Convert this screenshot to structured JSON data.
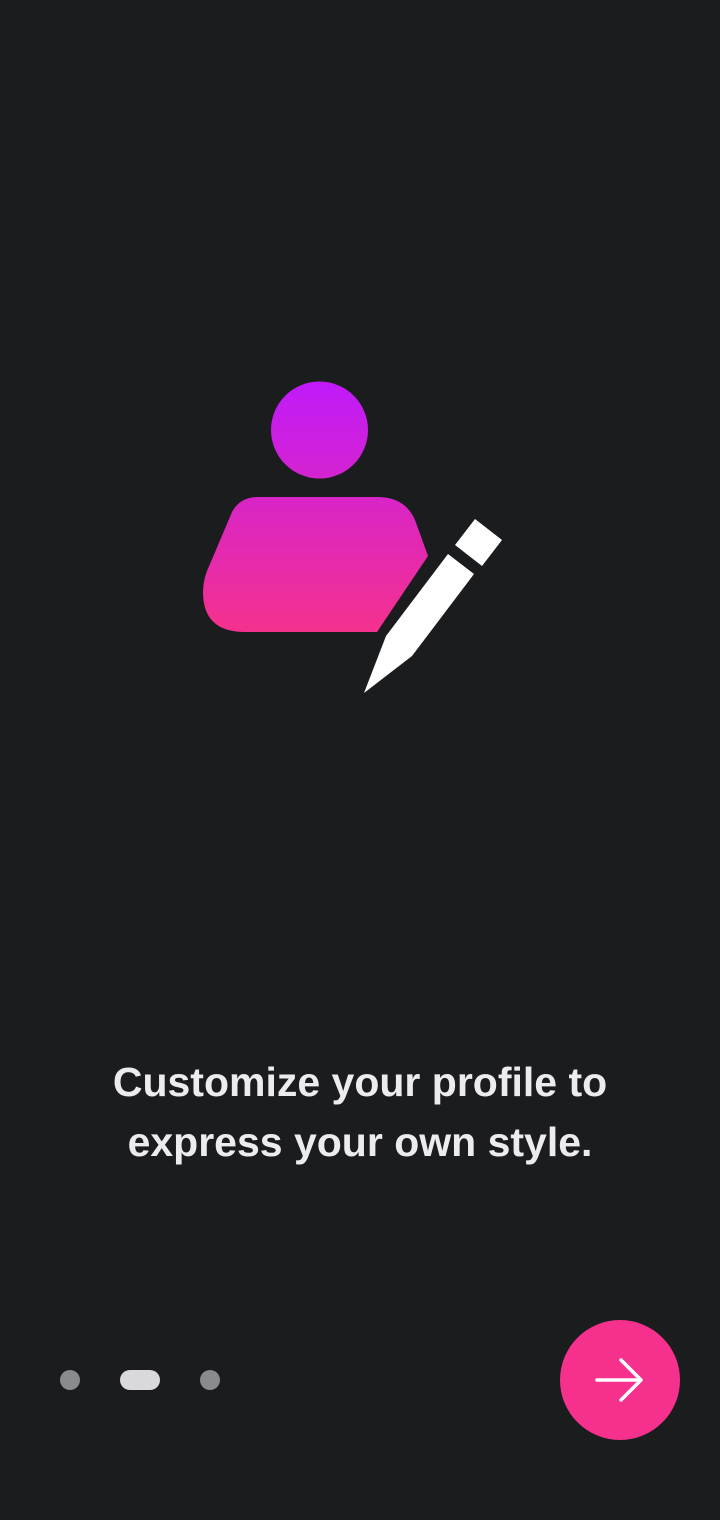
{
  "onboarding": {
    "headline": "Customize your profile to\nexpress your own style.",
    "illustration_icon": "profile-edit-icon",
    "page_indicator": {
      "total": 3,
      "current": 2
    },
    "next_button": {
      "icon": "arrow-right-icon"
    }
  },
  "colors": {
    "background": "#1b1c1e",
    "accent": "#f5318d",
    "gradient_top": "#c01afa",
    "gradient_bottom": "#f5318d",
    "text": "#ececee",
    "dot_inactive": "#8a8b8e",
    "dot_active": "#d9d9dc"
  }
}
